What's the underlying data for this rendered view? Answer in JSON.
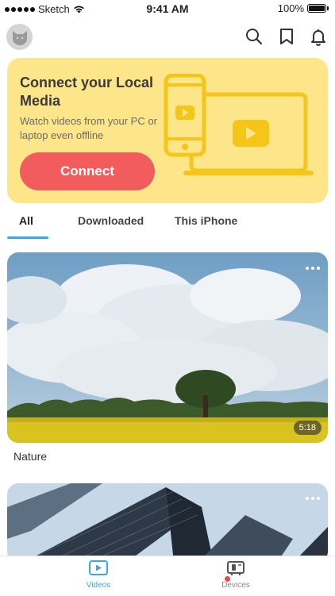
{
  "status_bar": {
    "carrier": "Sketch",
    "time": "9:41 AM",
    "battery": "100%"
  },
  "header": {
    "avatar_icon": "cat-avatar-icon",
    "icons": [
      "search-icon",
      "bookmark-icon",
      "bell-icon"
    ]
  },
  "promo": {
    "title": "Connect your Local Media",
    "subtitle": "Watch videos from your PC or laptop even offline",
    "button_label": "Connect",
    "colors": {
      "card_bg": "#fde68a",
      "button": "#f25c5c",
      "accent": "#f5c518"
    }
  },
  "tabs": [
    {
      "label": "All",
      "active": true
    },
    {
      "label": "Downloaded",
      "active": false
    },
    {
      "label": "This iPhone",
      "active": false
    }
  ],
  "videos": [
    {
      "title": "Nature",
      "duration": "5:18"
    },
    {
      "title": "",
      "duration": ""
    }
  ],
  "bottom_nav": [
    {
      "label": "Videos",
      "icon": "play-icon",
      "active": true,
      "color": "#3aa8e5"
    },
    {
      "label": "Devices",
      "icon": "devices-icon",
      "active": false,
      "color": "#8a8a8a",
      "badge": true
    }
  ]
}
